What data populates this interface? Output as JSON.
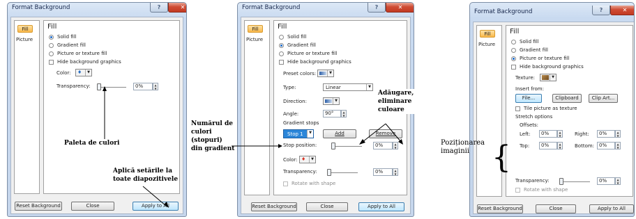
{
  "dialogs": [
    {
      "title": "Format Background",
      "tabs": [
        "Fill",
        "Picture"
      ],
      "heading": "Fill",
      "fill_options": [
        "Solid fill",
        "Gradient fill",
        "Picture or texture fill"
      ],
      "hide_bg": "Hide background graphics",
      "color_label": "Color:",
      "transparency_label": "Transparency:",
      "transparency": "0%",
      "buttons": [
        "Reset Background",
        "Close",
        "Apply to All"
      ]
    },
    {
      "title": "Format Background",
      "tabs": [
        "Fill",
        "Picture"
      ],
      "heading": "Fill",
      "fill_options": [
        "Solid fill",
        "Gradient fill",
        "Picture or texture fill"
      ],
      "hide_bg": "Hide background graphics",
      "preset_label": "Preset colors:",
      "type_label": "Type:",
      "type_value": "Linear",
      "direction_label": "Direction:",
      "angle_label": "Angle:",
      "angle_value": "90°",
      "stops_label": "Gradient stops",
      "stop_value": "Stop 1",
      "add": "Add",
      "remove": "Remove",
      "stop_pos_label": "Stop position:",
      "stop_pos": "0%",
      "color_label": "Color:",
      "transparency_label": "Transparency:",
      "transparency": "0%",
      "rotate": "Rotate with shape",
      "buttons": [
        "Reset Background",
        "Close",
        "Apply to All"
      ]
    },
    {
      "title": "Format Background",
      "tabs": [
        "Fill",
        "Picture"
      ],
      "heading": "Fill",
      "fill_options": [
        "Solid fill",
        "Gradient fill",
        "Picture or texture fill"
      ],
      "hide_bg": "Hide background graphics",
      "texture_label": "Texture:",
      "insert_from": "Insert from:",
      "file": "File...",
      "clipboard": "Clipboard",
      "clipart": "Clip Art...",
      "tile": "Tile picture as texture",
      "stretch": "Stretch options",
      "offsets": "Offsets:",
      "left": "Left:",
      "right": "Right:",
      "top": "Top:",
      "bottom": "Bottom:",
      "off_val": "0%",
      "transparency_label": "Transparency:",
      "transparency": "0%",
      "rotate": "Rotate with shape",
      "buttons": [
        "Reset Background",
        "Close",
        "Apply to All"
      ]
    }
  ],
  "annotations": {
    "palette": "Paleta de culori",
    "apply": [
      "Aplică setările la",
      "toate diapozitivele"
    ],
    "stops": [
      "Numărul de",
      "culori",
      "(stopuri)",
      "din gradient"
    ],
    "add_remove": [
      "Adăugare,",
      "eliminare",
      "culoare"
    ],
    "position": [
      "Poziționarea",
      "imaginii"
    ]
  }
}
